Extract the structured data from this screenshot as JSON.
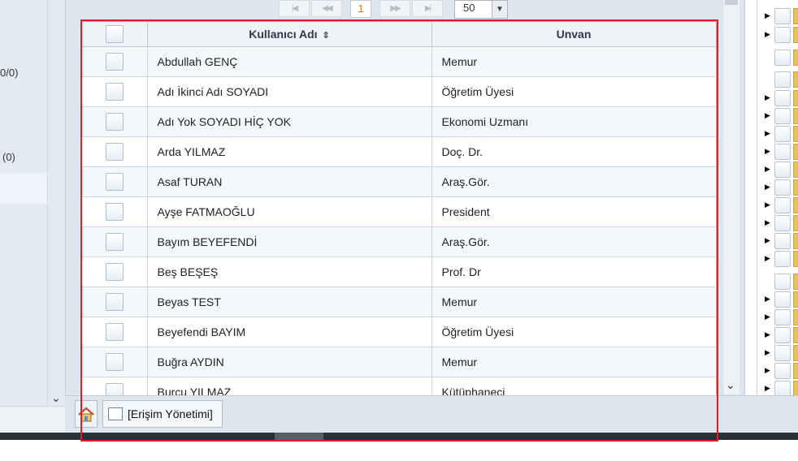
{
  "left_counts": [
    "0/0)",
    "(0)"
  ],
  "pager": {
    "first": "|◀",
    "prev": "◀◀",
    "page": "1",
    "next": "▶▶",
    "last": "▶|",
    "page_size": "50"
  },
  "grid": {
    "columns": [
      "Kullanıcı Adı",
      "Unvan"
    ],
    "rows": [
      {
        "name": "Abdullah GENÇ",
        "title": "Memur"
      },
      {
        "name": "Adı İkinci Adı SOYADI",
        "title": "Öğretim Üyesi"
      },
      {
        "name": "Adı Yok SOYADI HİÇ YOK",
        "title": "Ekonomi Uzmanı"
      },
      {
        "name": "Arda YILMAZ",
        "title": "Doç. Dr."
      },
      {
        "name": "Asaf TURAN",
        "title": "Araş.Gör."
      },
      {
        "name": "Ayşe FATMAOĞLU",
        "title": "President"
      },
      {
        "name": "Bayım BEYEFENDİ",
        "title": "Araş.Gör."
      },
      {
        "name": "Beş BEŞEŞ",
        "title": "Prof. Dr"
      },
      {
        "name": "Beyas TEST",
        "title": "Memur"
      },
      {
        "name": "Beyefendi BAYIM",
        "title": "Öğretim Üyesi"
      },
      {
        "name": "Buğra AYDIN",
        "title": "Memur"
      },
      {
        "name": "Burcu YILMAZ",
        "title": "Kütüphaneci"
      }
    ]
  },
  "tabs": {
    "home_icon": "home-icon",
    "active_label": "[Erişim Yönetimi]"
  },
  "colors": {
    "highlight": "#e41c24",
    "page_number": "#e6761a"
  }
}
